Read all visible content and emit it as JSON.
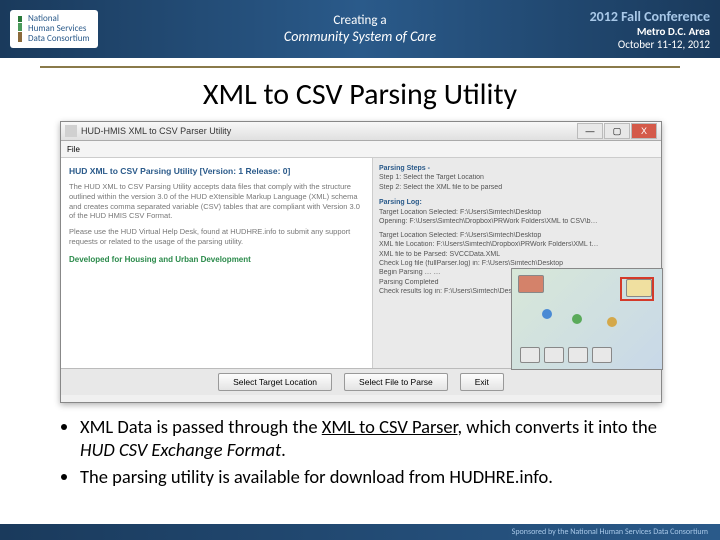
{
  "header": {
    "org_line1": "National",
    "org_line2": "Human Services",
    "org_line3": "Data Consortium",
    "center_line1": "Creating a",
    "center_line2": "Community System of Care",
    "conf": "2012 Fall Conference",
    "loc": "Metro D.C. Area",
    "dates": "October 11-12, 2012"
  },
  "slide_title": "XML to CSV Parsing Utility",
  "app": {
    "window_title": "HUD-HMIS XML to CSV Parser Utility",
    "menu_file": "File",
    "min": "—",
    "max": "▢",
    "close": "X",
    "left": {
      "heading": "HUD XML to CSV Parsing Utility [Version:  1 Release:  0]",
      "p1": "The HUD XML to CSV Parsing Utility accepts data files that comply with the structure outlined within the version 3.0 of the HUD eXtensible Markup Language (XML) schema and creates comma separated variable (CSV) tables that are compliant with Version 3.0 of the HUD HMIS CSV Format.",
      "p2": "Please use the HUD Virtual Help Desk, found at HUDHRE.info to submit any support requests or related to the usage of the parsing utility.",
      "dev": "Developed for Housing and Urban Development"
    },
    "right": {
      "steps_hd": "Parsing Steps -",
      "step1": "Step 1: Select the Target Location",
      "step2": "Step 2: Select the XML file to be parsed",
      "log_hd": "Parsing Log:",
      "l1": "Target Location Selected: F:\\Users\\Simtech\\Desktop",
      "l2": "Opening: F:\\Users\\Simtech\\Dropbox\\PRWork Folders\\XML to CSV\\b…",
      "l3": "Target Location Selected: F:\\Users\\Simtech\\Desktop",
      "l4": "XML file Location: F:\\Users\\Simtech\\Dropbox\\PRWork Folders\\XML t…",
      "l5": "XML file to be Parsed: SVCCData.XML",
      "l6": "Check Log file (fullParser.log) in: F:\\Users\\Simtech\\Desktop",
      "l7": "Begin Parsing  … …",
      "l8": "Parsing Completed",
      "l9": "Check results log in: F:\\Users\\Simtech\\Desktop"
    },
    "buttons": {
      "b1": "Select Target Location",
      "b2": "Select File to Parse",
      "b3": "Exit"
    }
  },
  "bullets": {
    "b1a": "XML Data is passed through the ",
    "b1b": "XML to CSV Parser",
    "b1c": ", which converts it into the ",
    "b1d": "HUD CSV Exchange Format",
    "b1e": ".",
    "b2": "The parsing utility is available for download from HUDHRE.info."
  },
  "footer": "Sponsored by the National Human Services Data Consortium"
}
